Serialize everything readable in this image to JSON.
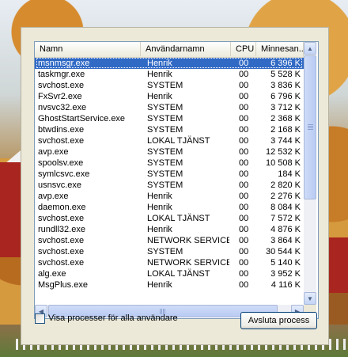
{
  "columns": {
    "name": "Namn",
    "user": "Användarnamn",
    "cpu": "CPU",
    "memory": "Minnesan..."
  },
  "processes": [
    {
      "name": "msnmsgr.exe",
      "user": "Henrik",
      "cpu": "00",
      "memory": "6 396 K"
    },
    {
      "name": "taskmgr.exe",
      "user": "Henrik",
      "cpu": "00",
      "memory": "5 528 K"
    },
    {
      "name": "svchost.exe",
      "user": "SYSTEM",
      "cpu": "00",
      "memory": "3 836 K"
    },
    {
      "name": "FxSvr2.exe",
      "user": "Henrik",
      "cpu": "00",
      "memory": "6 796 K"
    },
    {
      "name": "nvsvc32.exe",
      "user": "SYSTEM",
      "cpu": "00",
      "memory": "3 712 K"
    },
    {
      "name": "GhostStartService.exe",
      "user": "SYSTEM",
      "cpu": "00",
      "memory": "2 368 K"
    },
    {
      "name": "btwdins.exe",
      "user": "SYSTEM",
      "cpu": "00",
      "memory": "2 168 K"
    },
    {
      "name": "svchost.exe",
      "user": "LOKAL TJÄNST",
      "cpu": "00",
      "memory": "3 744 K"
    },
    {
      "name": "avp.exe",
      "user": "SYSTEM",
      "cpu": "00",
      "memory": "12 532 K"
    },
    {
      "name": "spoolsv.exe",
      "user": "SYSTEM",
      "cpu": "00",
      "memory": "10 508 K"
    },
    {
      "name": "symlcsvc.exe",
      "user": "SYSTEM",
      "cpu": "00",
      "memory": "184 K"
    },
    {
      "name": "usnsvc.exe",
      "user": "SYSTEM",
      "cpu": "00",
      "memory": "2 820 K"
    },
    {
      "name": "avp.exe",
      "user": "Henrik",
      "cpu": "00",
      "memory": "2 276 K"
    },
    {
      "name": "daemon.exe",
      "user": "Henrik",
      "cpu": "00",
      "memory": "8 084 K"
    },
    {
      "name": "svchost.exe",
      "user": "LOKAL TJÄNST",
      "cpu": "00",
      "memory": "7 572 K"
    },
    {
      "name": "rundll32.exe",
      "user": "Henrik",
      "cpu": "00",
      "memory": "4 876 K"
    },
    {
      "name": "svchost.exe",
      "user": "NETWORK SERVICE",
      "cpu": "00",
      "memory": "3 864 K"
    },
    {
      "name": "svchost.exe",
      "user": "SYSTEM",
      "cpu": "00",
      "memory": "30 544 K"
    },
    {
      "name": "svchost.exe",
      "user": "NETWORK SERVICE",
      "cpu": "00",
      "memory": "5 140 K"
    },
    {
      "name": "alg.exe",
      "user": "LOKAL TJÄNST",
      "cpu": "00",
      "memory": "3 952 K"
    },
    {
      "name": "MsgPlus.exe",
      "user": "Henrik",
      "cpu": "00",
      "memory": "4 116 K"
    }
  ],
  "selected_index": 0,
  "show_all_processes_label": "Visa processer för alla användare",
  "show_all_processes_checked": false,
  "end_process_button": "Avsluta process",
  "icons": {
    "scroll_up": "up-arrow-icon",
    "scroll_down": "down-arrow-icon",
    "scroll_left": "left-arrow-icon",
    "scroll_right": "right-arrow-icon"
  },
  "colors": {
    "selection": "#316ac5",
    "dialog_bg": "#ece9d8"
  }
}
